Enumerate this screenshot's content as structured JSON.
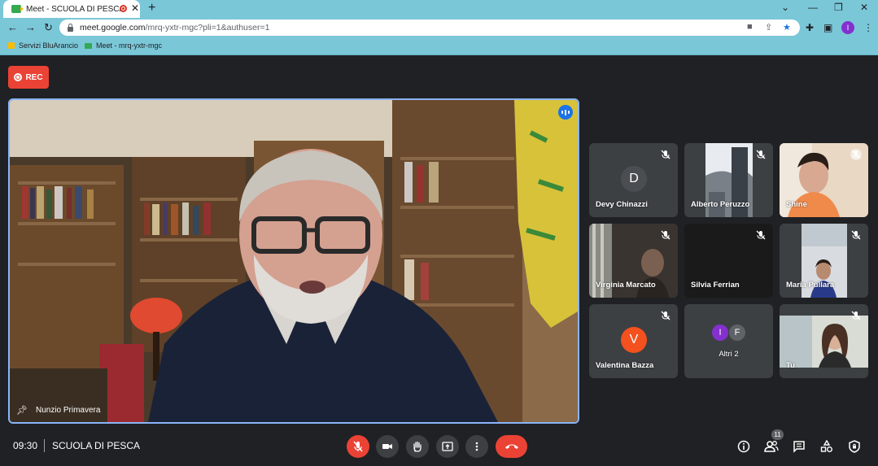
{
  "browser": {
    "tab_title": "Meet - SCUOLA DI PESCA",
    "url_host": "meet.google.com",
    "url_path": "/mrq-yxtr-mgc?pli=1&authuser=1",
    "profile_initial": "I",
    "bookmarks": [
      "Servizi BluArancio",
      "Meet - mrq-yxtr-mgc"
    ]
  },
  "meet": {
    "rec_label": "REC",
    "main_speaker": "Nunzio Primavera",
    "participants": [
      {
        "name": "Devy Chinazzi",
        "avatar": "D",
        "avatar_color": "#3c4043",
        "video": false
      },
      {
        "name": "Alberto Peruzzo",
        "video": true
      },
      {
        "name": "Shine",
        "video": true
      },
      {
        "name": "Virginia Marcato",
        "video": true
      },
      {
        "name": "Silvia Ferrian",
        "video": true
      },
      {
        "name": "Maria Pullara",
        "video": true
      },
      {
        "name": "Valentina Bazza",
        "avatar": "V",
        "avatar_color": "#f4511e",
        "video": false
      },
      {
        "name": "Altri 2",
        "avatars": [
          "I",
          "F"
        ]
      },
      {
        "name": "Tu",
        "video": true
      }
    ],
    "clock": "09:30",
    "meeting_name": "SCUOLA DI PESCA",
    "participant_count": "11",
    "colors": {
      "accent": "#8ab4f8",
      "danger": "#ea4335",
      "background": "#202124",
      "tile": "#3c4043"
    }
  }
}
